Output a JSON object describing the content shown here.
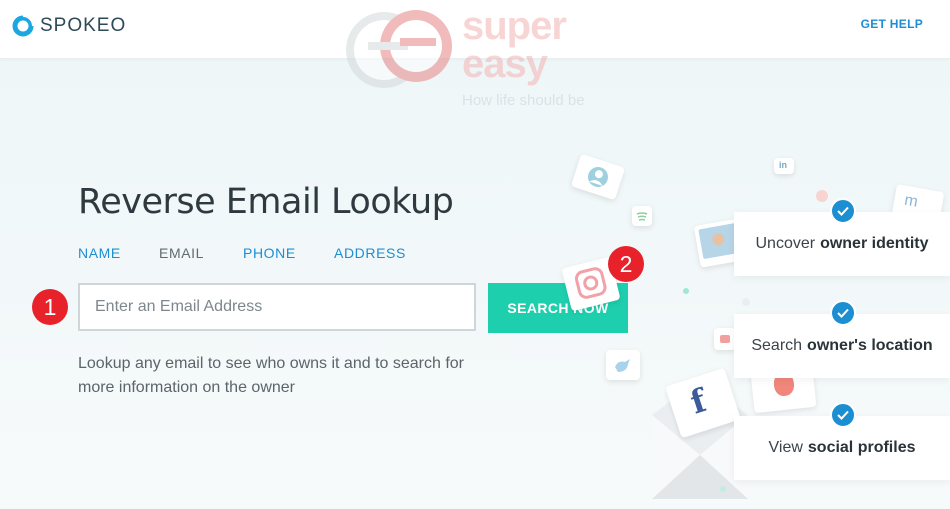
{
  "header": {
    "logo_text": "SPOKEO",
    "get_help": "GET HELP"
  },
  "watermark": {
    "line1": "super",
    "line2": "easy",
    "tagline": "How life should be"
  },
  "main": {
    "title": "Reverse Email Lookup",
    "tabs": [
      {
        "label": "NAME",
        "active": false
      },
      {
        "label": "EMAIL",
        "active": true
      },
      {
        "label": "PHONE",
        "active": false
      },
      {
        "label": "ADDRESS",
        "active": false
      }
    ],
    "search": {
      "placeholder": "Enter an Email Address",
      "value": "",
      "button_label": "SEARCH NOW"
    },
    "description": "Lookup any email to see who owns it and to search for more information on the owner"
  },
  "badges": [
    "1",
    "2"
  ],
  "features": [
    {
      "prefix": "Uncover",
      "bold": "owner identity"
    },
    {
      "prefix": "Search",
      "bold": "owner's location"
    },
    {
      "prefix": "View",
      "bold": "social profiles"
    }
  ],
  "colors": {
    "accent_blue": "#1b8fd1",
    "search_button": "#1ecfae",
    "badge_red": "#e8222a",
    "title_text": "#2f3a40"
  },
  "icons": [
    "spokeo-logo-icon",
    "check-icon",
    "facebook-icon",
    "instagram-icon",
    "linkedin-icon",
    "spotify-icon"
  ]
}
